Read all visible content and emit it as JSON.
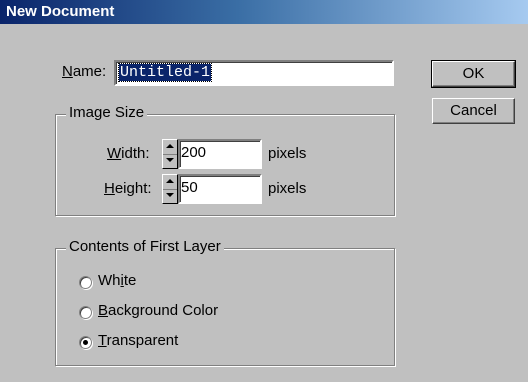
{
  "window": {
    "title": "New Document"
  },
  "name": {
    "label_prefix": "",
    "label_accel": "N",
    "label_rest": "ame:",
    "value": "Untitled-1"
  },
  "image_size": {
    "legend": "Image Size",
    "width": {
      "accel": "W",
      "rest": "idth:",
      "value": "200",
      "unit": "pixels"
    },
    "height": {
      "accel": "H",
      "rest": "eight:",
      "value": "50",
      "unit": "pixels"
    }
  },
  "contents": {
    "legend": "Contents of First Layer",
    "options": [
      {
        "pre": "Wh",
        "accel": "i",
        "post": "te",
        "checked": false
      },
      {
        "pre": "",
        "accel": "B",
        "post": "ackground Color",
        "checked": false
      },
      {
        "pre": "",
        "accel": "T",
        "post": "ransparent",
        "checked": true
      }
    ]
  },
  "buttons": {
    "ok": "OK",
    "cancel": "Cancel"
  }
}
